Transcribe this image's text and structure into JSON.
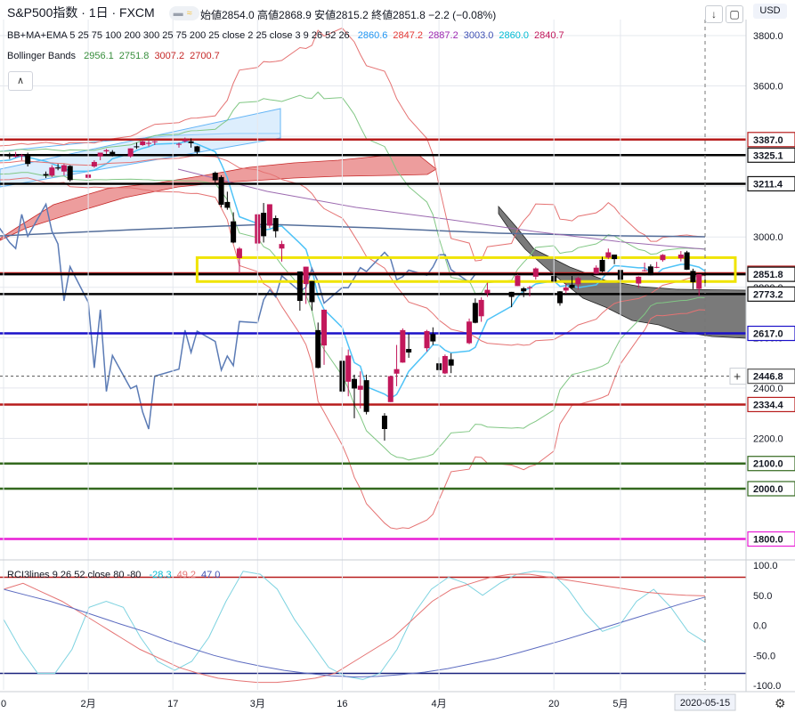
{
  "header": {
    "symbol": "S&P500指数 · 1日 · FXCM",
    "ohlc": "始値2854.0 高値2868.9 安値2815.2 終値2851.8 −2.2 (−0.08%)",
    "currency": "USD"
  },
  "indicators": {
    "main_label": "BB+MA+EMA 5 25 75 100 200 300 25 75 200 25 close 2 25 close 3 9 26 52 26",
    "main_values": [
      {
        "text": "2860.6",
        "color": "#2196f3"
      },
      {
        "text": "2847.2",
        "color": "#e53935"
      },
      {
        "text": "2887.2",
        "color": "#9c27b0"
      },
      {
        "text": "3003.0",
        "color": "#3f51b5"
      },
      {
        "text": "2860.0",
        "color": "#00bcd4"
      },
      {
        "text": "2840.7",
        "color": "#c2185b"
      }
    ],
    "bb_label": "Bollinger Bands",
    "bb_values": [
      {
        "text": "2956.1",
        "color": "#388e3c"
      },
      {
        "text": "2751.8",
        "color": "#388e3c"
      },
      {
        "text": "3007.2",
        "color": "#c62828"
      },
      {
        "text": "2700.7",
        "color": "#c62828"
      }
    ],
    "rci_label": "RCI3lines 9 26 52 close 80 -80",
    "rci_values": [
      {
        "text": "-28.3",
        "color": "#00bcd4"
      },
      {
        "text": "49.2",
        "color": "#e57373"
      },
      {
        "text": "47.0",
        "color": "#3f51b5"
      }
    ]
  },
  "chart_data": {
    "type": "candlestick",
    "ylim": [
      2050,
      3870
    ],
    "price_ticks": [
      "3800.0",
      "3600.0",
      "3400.0",
      "3200.0",
      "3000.0",
      "2800.0",
      "2600.0",
      "2400.0",
      "2200.0",
      "2000.0"
    ],
    "x_tick_labels": [
      "0",
      "2月",
      "17",
      "3月",
      "16",
      "4月",
      "20",
      "5月"
    ],
    "x_tick_dates": [
      "2020-01-20",
      "2020-02-03",
      "2020-02-17",
      "2020-03-02",
      "2020-03-16",
      "2020-04-01",
      "2020-04-20",
      "2020-05-01"
    ],
    "cursor_date": "2020-05-15",
    "candles": [
      {
        "d": "2020-01-10",
        "o": 3262,
        "h": 3275,
        "l": 3250,
        "c": 3265
      },
      {
        "d": "2020-01-13",
        "o": 3265,
        "h": 3285,
        "l": 3258,
        "c": 3282
      },
      {
        "d": "2020-01-14",
        "o": 3282,
        "h": 3292,
        "l": 3270,
        "c": 3275
      },
      {
        "d": "2020-01-15",
        "o": 3275,
        "h": 3295,
        "l": 3268,
        "c": 3288
      },
      {
        "d": "2020-01-16",
        "o": 3288,
        "h": 3318,
        "l": 3285,
        "c": 3315
      },
      {
        "d": "2020-01-17",
        "o": 3315,
        "h": 3330,
        "l": 3308,
        "c": 3328
      },
      {
        "d": "2020-01-21",
        "o": 3328,
        "h": 3335,
        "l": 3310,
        "c": 3320
      },
      {
        "d": "2020-01-22",
        "o": 3320,
        "h": 3338,
        "l": 3315,
        "c": 3322
      },
      {
        "d": "2020-01-23",
        "o": 3322,
        "h": 3330,
        "l": 3305,
        "c": 3325
      },
      {
        "d": "2020-01-24",
        "o": 3325,
        "h": 3335,
        "l": 3280,
        "c": 3290
      },
      {
        "d": "2020-01-27",
        "o": 3250,
        "h": 3260,
        "l": 3234,
        "c": 3244
      },
      {
        "d": "2020-01-28",
        "o": 3244,
        "h": 3285,
        "l": 3238,
        "c": 3276
      },
      {
        "d": "2020-01-29",
        "o": 3276,
        "h": 3290,
        "l": 3265,
        "c": 3272
      },
      {
        "d": "2020-01-30",
        "o": 3260,
        "h": 3290,
        "l": 3245,
        "c": 3285
      },
      {
        "d": "2020-01-31",
        "o": 3282,
        "h": 3285,
        "l": 3220,
        "c": 3226
      },
      {
        "d": "2020-02-03",
        "o": 3235,
        "h": 3268,
        "l": 3230,
        "c": 3248
      },
      {
        "d": "2020-02-04",
        "o": 3280,
        "h": 3305,
        "l": 3275,
        "c": 3298
      },
      {
        "d": "2020-02-05",
        "o": 3320,
        "h": 3335,
        "l": 3305,
        "c": 3335
      },
      {
        "d": "2020-02-06",
        "o": 3340,
        "h": 3350,
        "l": 3330,
        "c": 3345
      },
      {
        "d": "2020-02-07",
        "o": 3338,
        "h": 3345,
        "l": 3320,
        "c": 3328
      },
      {
        "d": "2020-02-10",
        "o": 3320,
        "h": 3352,
        "l": 3315,
        "c": 3352
      },
      {
        "d": "2020-02-11",
        "o": 3360,
        "h": 3375,
        "l": 3350,
        "c": 3357
      },
      {
        "d": "2020-02-12",
        "o": 3365,
        "h": 3385,
        "l": 3362,
        "c": 3380
      },
      {
        "d": "2020-02-13",
        "o": 3370,
        "h": 3385,
        "l": 3360,
        "c": 3374
      },
      {
        "d": "2020-02-14",
        "o": 3378,
        "h": 3382,
        "l": 3365,
        "c": 3380
      },
      {
        "d": "2020-02-18",
        "o": 3370,
        "h": 3375,
        "l": 3355,
        "c": 3370
      },
      {
        "d": "2020-02-19",
        "o": 3380,
        "h": 3395,
        "l": 3375,
        "c": 3386
      },
      {
        "d": "2020-02-20",
        "o": 3380,
        "h": 3392,
        "l": 3355,
        "c": 3373
      },
      {
        "d": "2020-02-21",
        "o": 3360,
        "h": 3362,
        "l": 3328,
        "c": 3338
      },
      {
        "d": "2020-02-24",
        "o": 3255,
        "h": 3260,
        "l": 3215,
        "c": 3225
      },
      {
        "d": "2020-02-25",
        "o": 3238,
        "h": 3245,
        "l": 3118,
        "c": 3128
      },
      {
        "d": "2020-02-26",
        "o": 3139,
        "h": 3180,
        "l": 3108,
        "c": 3116
      },
      {
        "d": "2020-02-27",
        "o": 3062,
        "h": 3098,
        "l": 2975,
        "c": 2978
      },
      {
        "d": "2020-02-28",
        "o": 2916,
        "h": 2960,
        "l": 2855,
        "c": 2954
      },
      {
        "d": "2020-03-02",
        "o": 2974,
        "h": 3092,
        "l": 2945,
        "c": 3090
      },
      {
        "d": "2020-03-03",
        "o": 3096,
        "h": 3135,
        "l": 2978,
        "c": 3003
      },
      {
        "d": "2020-03-04",
        "o": 3045,
        "h": 3130,
        "l": 3035,
        "c": 3130
      },
      {
        "d": "2020-03-05",
        "o": 3075,
        "h": 3085,
        "l": 2998,
        "c": 3023
      },
      {
        "d": "2020-03-06",
        "o": 2954,
        "h": 2985,
        "l": 2902,
        "c": 2972
      },
      {
        "d": "2020-03-09",
        "o": 2863,
        "h": 2863,
        "l": 2707,
        "c": 2746
      },
      {
        "d": "2020-03-10",
        "o": 2813,
        "h": 2882,
        "l": 2734,
        "c": 2882
      },
      {
        "d": "2020-03-11",
        "o": 2825,
        "h": 2825,
        "l": 2707,
        "c": 2741
      },
      {
        "d": "2020-03-12",
        "o": 2630,
        "h": 2660,
        "l": 2478,
        "c": 2480
      },
      {
        "d": "2020-03-13",
        "o": 2569,
        "h": 2711,
        "l": 2492,
        "c": 2711
      },
      {
        "d": "2020-03-16",
        "o": 2508,
        "h": 2562,
        "l": 2380,
        "c": 2386
      },
      {
        "d": "2020-03-17",
        "o": 2425,
        "h": 2553,
        "l": 2367,
        "c": 2529
      },
      {
        "d": "2020-03-18",
        "o": 2436,
        "h": 2453,
        "l": 2280,
        "c": 2398
      },
      {
        "d": "2020-03-19",
        "o": 2393,
        "h": 2466,
        "l": 2319,
        "c": 2409
      },
      {
        "d": "2020-03-20",
        "o": 2431,
        "h": 2453,
        "l": 2295,
        "c": 2305
      },
      {
        "d": "2020-03-23",
        "o": 2290,
        "h": 2300,
        "l": 2191,
        "c": 2237
      },
      {
        "d": "2020-03-24",
        "o": 2344,
        "h": 2449,
        "l": 2344,
        "c": 2447
      },
      {
        "d": "2020-03-25",
        "o": 2457,
        "h": 2571,
        "l": 2407,
        "c": 2475
      },
      {
        "d": "2020-03-26",
        "o": 2501,
        "h": 2637,
        "l": 2500,
        "c": 2630
      },
      {
        "d": "2020-03-27",
        "o": 2555,
        "h": 2615,
        "l": 2520,
        "c": 2541
      },
      {
        "d": "2020-03-30",
        "o": 2558,
        "h": 2631,
        "l": 2545,
        "c": 2626
      },
      {
        "d": "2020-03-31",
        "o": 2614,
        "h": 2641,
        "l": 2571,
        "c": 2585
      },
      {
        "d": "2020-04-01",
        "o": 2498,
        "h": 2522,
        "l": 2447,
        "c": 2471
      },
      {
        "d": "2020-04-02",
        "o": 2458,
        "h": 2533,
        "l": 2455,
        "c": 2527
      },
      {
        "d": "2020-04-03",
        "o": 2514,
        "h": 2538,
        "l": 2459,
        "c": 2489
      },
      {
        "d": "2020-04-06",
        "o": 2578,
        "h": 2676,
        "l": 2574,
        "c": 2664
      },
      {
        "d": "2020-04-07",
        "o": 2738,
        "h": 2756,
        "l": 2657,
        "c": 2659
      },
      {
        "d": "2020-04-08",
        "o": 2685,
        "h": 2760,
        "l": 2663,
        "c": 2750
      },
      {
        "d": "2020-04-09",
        "o": 2776,
        "h": 2818,
        "l": 2762,
        "c": 2790
      },
      {
        "d": "2020-04-13",
        "o": 2782,
        "h": 2782,
        "l": 2721,
        "c": 2762
      },
      {
        "d": "2020-04-14",
        "o": 2805,
        "h": 2851,
        "l": 2805,
        "c": 2846
      },
      {
        "d": "2020-04-15",
        "o": 2796,
        "h": 2801,
        "l": 2761,
        "c": 2784
      },
      {
        "d": "2020-04-16",
        "o": 2799,
        "h": 2806,
        "l": 2764,
        "c": 2800
      },
      {
        "d": "2020-04-17",
        "o": 2842,
        "h": 2879,
        "l": 2831,
        "c": 2875
      },
      {
        "d": "2020-04-20",
        "o": 2845,
        "h": 2868,
        "l": 2821,
        "c": 2823
      },
      {
        "d": "2020-04-21",
        "o": 2784,
        "h": 2785,
        "l": 2727,
        "c": 2737
      },
      {
        "d": "2020-04-22",
        "o": 2787,
        "h": 2815,
        "l": 2775,
        "c": 2799
      },
      {
        "d": "2020-04-23",
        "o": 2810,
        "h": 2845,
        "l": 2794,
        "c": 2798
      },
      {
        "d": "2020-04-24",
        "o": 2812,
        "h": 2842,
        "l": 2791,
        "c": 2837
      },
      {
        "d": "2020-04-27",
        "o": 2854,
        "h": 2887,
        "l": 2853,
        "c": 2878
      },
      {
        "d": "2020-04-28",
        "o": 2909,
        "h": 2921,
        "l": 2860,
        "c": 2863
      },
      {
        "d": "2020-04-29",
        "o": 2918,
        "h": 2954,
        "l": 2912,
        "c": 2939
      },
      {
        "d": "2020-04-30",
        "o": 2930,
        "h": 2930,
        "l": 2892,
        "c": 2912
      },
      {
        "d": "2020-05-01",
        "o": 2869,
        "h": 2869,
        "l": 2821,
        "c": 2830
      },
      {
        "d": "2020-05-04",
        "o": 2815,
        "h": 2844,
        "l": 2797,
        "c": 2842
      },
      {
        "d": "2020-05-05",
        "o": 2868,
        "h": 2898,
        "l": 2863,
        "c": 2868
      },
      {
        "d": "2020-05-06",
        "o": 2883,
        "h": 2891,
        "l": 2847,
        "c": 2848
      },
      {
        "d": "2020-05-07",
        "o": 2878,
        "h": 2901,
        "l": 2876,
        "c": 2881
      },
      {
        "d": "2020-05-08",
        "o": 2908,
        "h": 2932,
        "l": 2902,
        "c": 2929
      },
      {
        "d": "2020-05-11",
        "o": 2915,
        "h": 2944,
        "l": 2903,
        "c": 2930
      },
      {
        "d": "2020-05-12",
        "o": 2939,
        "h": 2945,
        "l": 2869,
        "c": 2870
      },
      {
        "d": "2020-05-13",
        "o": 2865,
        "h": 2874,
        "l": 2793,
        "c": 2820
      },
      {
        "d": "2020-05-14",
        "o": 2794,
        "h": 2852,
        "l": 2766,
        "c": 2852
      },
      {
        "d": "2020-05-15",
        "o": 2854,
        "h": 2869,
        "l": 2815,
        "c": 2852
      }
    ],
    "horizontal_lines": [
      {
        "value": 3387.0,
        "label": "3387.0",
        "color": "#b71c1c"
      },
      {
        "value": 3325.1,
        "label": "3325.1",
        "color": "#000000"
      },
      {
        "value": 3211.4,
        "label": "3211.4",
        "color": "#000000"
      },
      {
        "value": 2855.8,
        "label": "2855.8",
        "color": "#b71c1c"
      },
      {
        "value": 2851.8,
        "label": "2851.8",
        "color": "#000000"
      },
      {
        "value": 2773.2,
        "label": "2773.2",
        "color": "#000000"
      },
      {
        "value": 2617.0,
        "label": "2617.0",
        "color": "#1a10c9"
      },
      {
        "value": 2446.8,
        "label": "2446.8",
        "color": "#555555"
      },
      {
        "value": 2334.4,
        "label": "2334.4",
        "color": "#b71c1c"
      },
      {
        "value": 2100.0,
        "label": "2100.0",
        "color": "#33691e"
      },
      {
        "value": 2000.0,
        "label": "2000.0",
        "color": "#33691e"
      },
      {
        "value": 1800.0,
        "label": "1800.0",
        "color": "#e91ed6"
      }
    ],
    "highlight_zone": {
      "from": 2823,
      "to": 2918,
      "start_date": "2020-02-21",
      "end_date": "2020-05-20",
      "color": "#f0e400"
    },
    "rci": {
      "ylim": [
        -100,
        100
      ],
      "ticks": [
        "100.0",
        "50.0",
        "0.0",
        "-50.0",
        "-100.0"
      ],
      "levels": [
        80,
        -80
      ],
      "series": [
        {
          "color": "#7ed3e0",
          "values": [
            10,
            -40,
            -80,
            -80,
            -40,
            30,
            40,
            30,
            -20,
            -60,
            -75,
            -60,
            -20,
            40,
            90,
            85,
            60,
            10,
            -30,
            -70,
            -85,
            -90,
            -80,
            -40,
            20,
            60,
            80,
            70,
            50,
            70,
            85,
            90,
            88,
            60,
            20,
            -10,
            0,
            40,
            60,
            30,
            -10,
            -28
          ]
        },
        {
          "color": "#e57373",
          "values": [
            60,
            70,
            55,
            40,
            20,
            0,
            -20,
            -40,
            -55,
            -70,
            -80,
            -88,
            -92,
            -95,
            -95,
            -92,
            -88,
            -80,
            -60,
            -40,
            -20,
            10,
            40,
            60,
            70,
            80,
            85,
            85,
            80,
            75,
            70,
            65,
            60,
            55,
            52,
            50,
            49
          ]
        },
        {
          "color": "#5c6bc0",
          "values": [
            60,
            50,
            40,
            28,
            15,
            2,
            -10,
            -25,
            -38,
            -50,
            -60,
            -68,
            -75,
            -80,
            -84,
            -86,
            -85,
            -82,
            -78,
            -72,
            -64,
            -56,
            -46,
            -35,
            -24,
            -12,
            0,
            12,
            24,
            36,
            47
          ]
        }
      ]
    }
  },
  "colors": {
    "bull": "#c2185b",
    "bear": "#000000",
    "cloud_bear": "#e57373",
    "cloud_bull": "#424242",
    "grid": "#e5e8ee"
  },
  "icons": {
    "down": "download-icon",
    "fullscreen": "fullscreen-icon",
    "collapse": "chevron-up-icon",
    "settings": "gear-icon",
    "crosshair": "plus-icon"
  }
}
